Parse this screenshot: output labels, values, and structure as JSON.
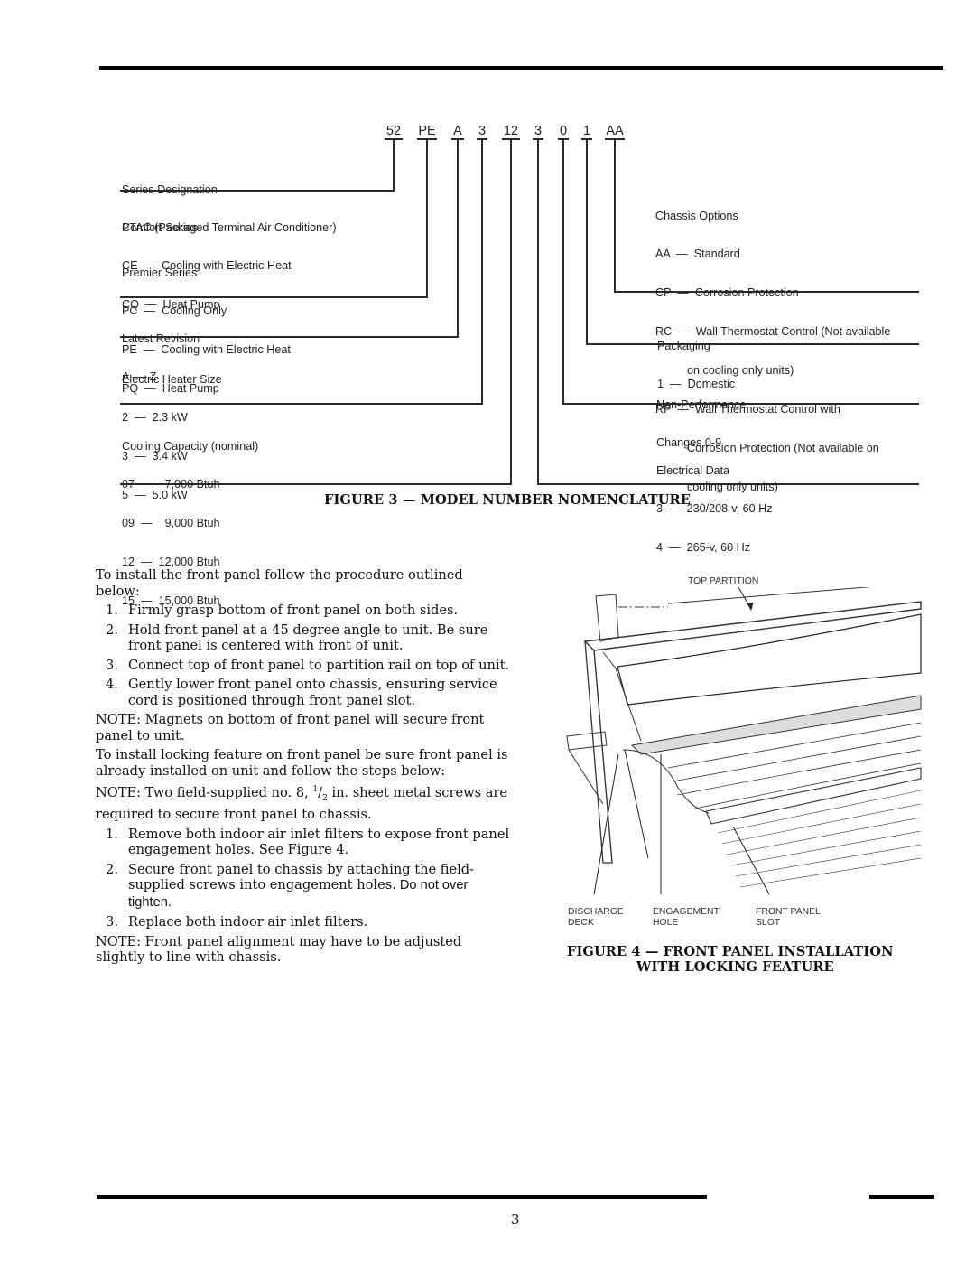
{
  "figure3": {
    "caption": "FIGURE 3 — MODEL NUMBER NOMENCLATURE",
    "model_code": [
      "52",
      "PE",
      "A",
      "3",
      "12",
      "3",
      "0",
      "1",
      "AA"
    ],
    "left_groups": [
      {
        "title": "Series Designation",
        "lines": [
          "PTAC (Packaged Terminal Air Conditioner)"
        ]
      },
      {
        "title": "Comfort Series",
        "lines": [
          "CE  —  Cooling with Electric Heat",
          "CQ  —  Heat Pump"
        ]
      },
      {
        "title": "Premier Series",
        "lines": [
          "PC  —  Cooling Only",
          "PE  —  Cooling with Electric Heat",
          "PQ  —  Heat Pump"
        ]
      },
      {
        "title": "Latest Revision",
        "lines": [
          "A —  Z"
        ]
      },
      {
        "title": "Electric Heater Size",
        "lines": [
          "2  —  2.3 kW",
          "3  —  3.4 kW",
          "5  —  5.0 kW"
        ]
      },
      {
        "title": "Cooling Capacity (nominal)",
        "lines": [
          "07  —    7,000 Btuh",
          "09  —    9,000 Btuh",
          "12  —  12,000 Btuh",
          "15  —  15,000 Btuh"
        ]
      }
    ],
    "right_groups": [
      {
        "title": "Chassis Options",
        "lines": [
          "AA  —  Standard",
          "CP  —  Corrosion Protection",
          "RC  —  Wall Thermostat Control (Not available",
          "          on cooling only units)",
          "RP  —  Wall Thermostat Control with",
          "          Corrosion Protection (Not available on",
          "          cooling only units)"
        ]
      },
      {
        "title": "Packaging",
        "lines": [
          "1  —  Domestic"
        ]
      },
      {
        "title": "Non-Performance",
        "lines": [
          "Changes 0-9"
        ]
      },
      {
        "title": "Electrical Data",
        "lines": [
          "3  —  230/208-v, 60 Hz",
          "4  —  265-v, 60 Hz"
        ]
      }
    ]
  },
  "instructions": {
    "intro": "To install the front panel follow the procedure outlined below:",
    "steps_install": [
      {
        "num": "1.",
        "text": "Firmly grasp bottom of front panel on both sides."
      },
      {
        "num": "2.",
        "text": "Hold front panel at a 45 degree angle to unit. Be sure front panel is centered with front of unit."
      },
      {
        "num": "3.",
        "text": "Connect top of front panel to partition rail on top of unit."
      },
      {
        "num": "4.",
        "text": "Gently lower front panel onto chassis, ensuring service cord is positioned through front panel slot."
      }
    ],
    "note_magnets": "NOTE: Magnets on bottom of front panel will secure front panel to unit.",
    "locking_intro": "To install locking feature on front panel be sure front panel is already installed on unit and follow the steps below:",
    "note_screws_pre": "NOTE: Two field-supplied no. 8, ",
    "note_screws_frac_num": "1",
    "note_screws_frac_den": "2",
    "note_screws_post": " in. sheet metal screws are required to secure front panel to chassis.",
    "steps_locking": [
      {
        "num": "1.",
        "text": "Remove both indoor air inlet filters to expose front panel engagement holes. See Figure 4."
      },
      {
        "num": "2.",
        "text": "Secure front panel to chassis by attaching the field-supplied screws into engagement holes.",
        "text_sans": " Do not over tighten."
      },
      {
        "num": "3.",
        "text": "Replace both indoor air inlet filters."
      }
    ],
    "note_alignment": "NOTE: Front panel alignment may have to be adjusted slightly to line with chassis."
  },
  "figure4": {
    "caption_line1": "FIGURE 4 — FRONT PANEL INSTALLATION",
    "caption_line2": "WITH LOCKING FEATURE",
    "labels": {
      "top_partition": "TOP PARTITION",
      "discharge_deck": "DISCHARGE\nDECK",
      "engagement_hole": "ENGAGEMENT\nHOLE",
      "front_panel_slot": "FRONT PANEL\nSLOT"
    }
  },
  "footer": {
    "page_number": "3"
  }
}
